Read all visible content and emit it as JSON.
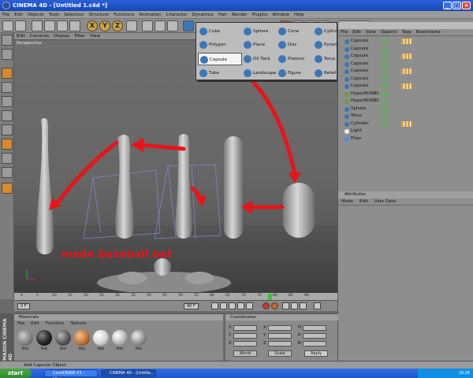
{
  "window": {
    "title": "CINEMA 4D - [Untitled 1.c4d *]"
  },
  "menubar": [
    "File",
    "Edit",
    "Objects",
    "Tools",
    "Selection",
    "Structure",
    "Functions",
    "Animation",
    "Character",
    "Dynamics",
    "Hair",
    "Render",
    "Plugins",
    "Window",
    "Help"
  ],
  "toolbar": {
    "axis_buttons": [
      "X",
      "Y",
      "Z"
    ]
  },
  "viewport": {
    "menu": [
      "Edit",
      "Cameras",
      "Display",
      "Filter",
      "View"
    ],
    "label": "Perspective"
  },
  "popup": {
    "items": [
      {
        "label": "Cube"
      },
      {
        "label": "Sphere"
      },
      {
        "label": "Cone"
      },
      {
        "label": "Cylinder"
      },
      {
        "label": "Polygon"
      },
      {
        "label": "Plane"
      },
      {
        "label": "Disc"
      },
      {
        "label": "Pyramid"
      },
      {
        "label": "Capsule",
        "selected": true
      },
      {
        "label": "Oil Tank"
      },
      {
        "label": "Platonic"
      },
      {
        "label": "Torus"
      },
      {
        "label": "Tube"
      },
      {
        "label": "Landscape"
      },
      {
        "label": "Figure"
      },
      {
        "label": "Relief"
      }
    ]
  },
  "objects_panel": {
    "menu": [
      "File",
      "Edit",
      "View",
      "Objects",
      "Tags",
      "Bookmarks"
    ],
    "rows": [
      "Capsule",
      "Capsule",
      "Capsule",
      "Capsule",
      "Capsule",
      "Capsule",
      "Capsule",
      "HyperNURBS",
      "HyperNURBS",
      "Sphere",
      "Torus",
      "Cylinder",
      "Light",
      "Floor"
    ]
  },
  "attributes_panel": {
    "title": "Attributes",
    "menu": [
      "Mode",
      "Edit",
      "User Data"
    ]
  },
  "timeline": {
    "ticks": [
      "0",
      "5",
      "10",
      "15",
      "20",
      "25",
      "30",
      "35",
      "40",
      "45",
      "50",
      "55",
      "60",
      "65",
      "70",
      "75",
      "80",
      "85",
      "90"
    ],
    "current_frame": "0 F",
    "end_frame": "90 F"
  },
  "materials_panel": {
    "title": "Materials",
    "menu": [
      "File",
      "Edit",
      "Function",
      "Texture"
    ],
    "materials": [
      {
        "name": "Mat",
        "color": "#8a8a8a"
      },
      {
        "name": "Mat",
        "color": "#2a2a2a"
      },
      {
        "name": "Mat",
        "color": "#5e5e5e"
      },
      {
        "name": "Mat",
        "color": "#c87a3a"
      },
      {
        "name": "Mat",
        "color": "#d8d8d8"
      },
      {
        "name": "Mat",
        "color": "#bcbcbc"
      },
      {
        "name": "Mat",
        "color": "#9a9a9a"
      }
    ]
  },
  "coordinates_panel": {
    "title": "Coordinates",
    "rows": [
      "X",
      "Y",
      "Z"
    ],
    "cols": [
      "X",
      "Y",
      "Z"
    ],
    "hpb": [
      "H",
      "P",
      "B"
    ],
    "mode": "World",
    "scale": "Scale",
    "apply": "Apply"
  },
  "statusbar": "Add Capsule Object",
  "maxon_label": "MAXON CINEMA 4D",
  "annotation": "made baseball bat",
  "taskbar": {
    "start": "start",
    "tasks": [
      "CorelDRAW X3 - [Gra...",
      "CINEMA 4D - [Untitle..."
    ],
    "clock": "10:26"
  },
  "colors": {
    "arrow": "#e8141a",
    "title_bar": "#2a60d8",
    "start_green": "#3a9a3a"
  }
}
